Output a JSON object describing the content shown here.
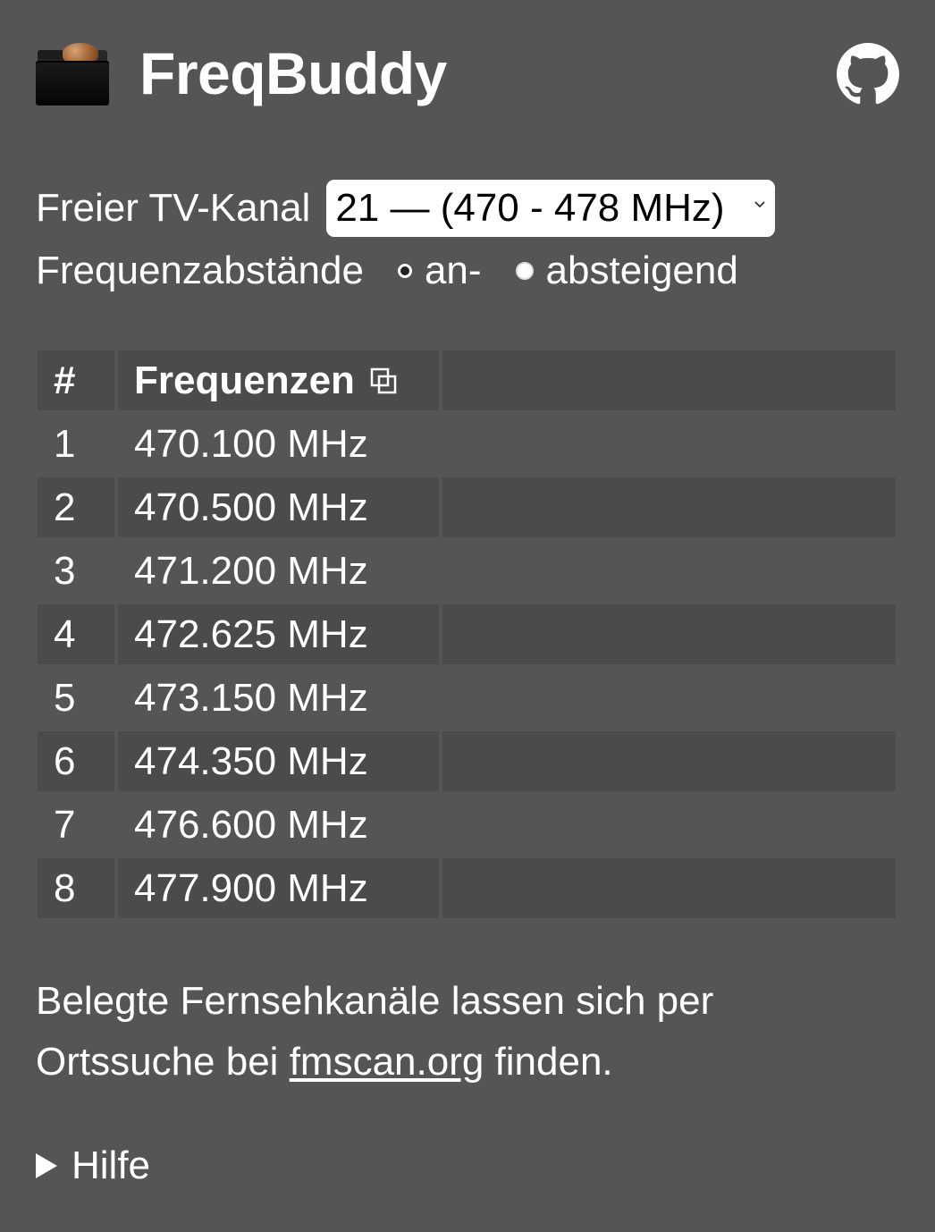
{
  "header": {
    "logo_icon": "folder-brain-icon",
    "title": "FreqBuddy",
    "github_icon": "github-icon"
  },
  "channel": {
    "label": "Freier TV-Kanal",
    "selected": "21 — (470 - 478 MHz)"
  },
  "order": {
    "label": "Frequenzabstände",
    "options": [
      {
        "label": "an-",
        "checked": false
      },
      {
        "label": "absteigend",
        "checked": true
      }
    ]
  },
  "table": {
    "headers": [
      "#",
      "Frequenzen"
    ],
    "copy_icon": "copy-icon",
    "rows": [
      {
        "n": "1",
        "freq": "470.100 MHz"
      },
      {
        "n": "2",
        "freq": "470.500 MHz"
      },
      {
        "n": "3",
        "freq": "471.200 MHz"
      },
      {
        "n": "4",
        "freq": "472.625 MHz"
      },
      {
        "n": "5",
        "freq": "473.150 MHz"
      },
      {
        "n": "6",
        "freq": "474.350 MHz"
      },
      {
        "n": "7",
        "freq": "476.600 MHz"
      },
      {
        "n": "8",
        "freq": "477.900 MHz"
      }
    ]
  },
  "info": {
    "line1": "Belegte Fernsehkanäle lassen sich per",
    "line2_prefix": "Ortssuche bei ",
    "link_text": "fmscan.org",
    "line2_suffix": " finden."
  },
  "help": {
    "label": "Hilfe"
  },
  "colors": {
    "background": "#555555",
    "row_shade": "#4b4b4b",
    "text": "#ffffff"
  }
}
